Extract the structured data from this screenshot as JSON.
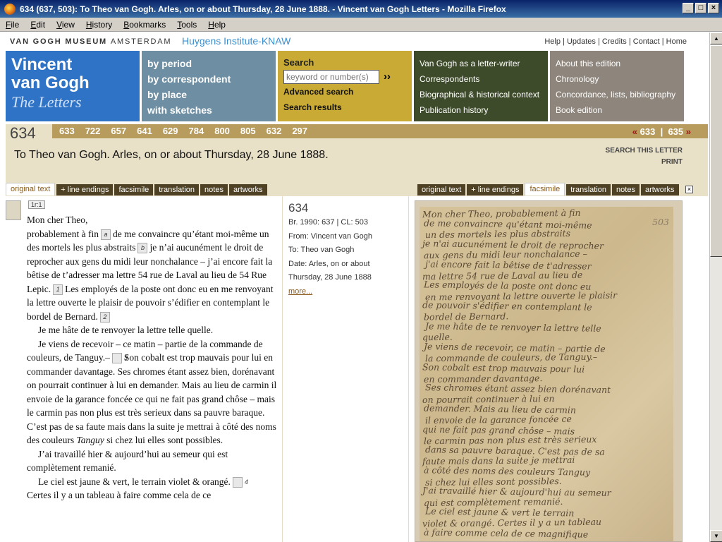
{
  "window": {
    "title": "634 (637, 503): To Theo van Gogh. Arles, on or about Thursday, 28 June 1888. - Vincent van Gogh Letters - Mozilla Firefox"
  },
  "menu": [
    "File",
    "Edit",
    "View",
    "History",
    "Bookmarks",
    "Tools",
    "Help"
  ],
  "site": {
    "museum": "VAN GOGH MUSEUM",
    "city": "AMSTERDAM",
    "huygens": "Huygens Institute-KNAW",
    "toplinks": [
      "Help",
      "Updates",
      "Credits",
      "Contact",
      "Home"
    ]
  },
  "brand": {
    "line1": "Vincent",
    "line2": "van Gogh",
    "line3": "The Letters"
  },
  "nav_browse": [
    "by period",
    "by correspondent",
    "by place",
    "with sketches"
  ],
  "search": {
    "title": "Search",
    "placeholder": "keyword or number(s)",
    "go": "››",
    "advanced": "Advanced search",
    "results": "Search results"
  },
  "nav_context": [
    "Van Gogh as a letter-writer",
    "Correspondents",
    "Biographical & historical context",
    "Publication history"
  ],
  "nav_edition": [
    "About this edition",
    "Chronology",
    "Concordance, lists, bibliography",
    "Book edition"
  ],
  "letter": {
    "number": "634",
    "related": [
      "633",
      "722",
      "657",
      "641",
      "629",
      "784",
      "800",
      "805",
      "632",
      "297"
    ],
    "prev": "633",
    "next": "635",
    "prev_arrow": "«",
    "next_arrow": "»",
    "title": "To Theo van Gogh. Arles, on or about Thursday, 28 June 1888.",
    "search_this": "SEARCH THIS LETTER",
    "print": "PRINT"
  },
  "tabs_left": [
    "original text",
    "+ line endings",
    "facsimile",
    "translation",
    "notes",
    "artworks"
  ],
  "tabs_right": [
    "original text",
    "+ line endings",
    "facsimile",
    "translation",
    "notes",
    "artworks"
  ],
  "page_marker": "1r:1",
  "text": {
    "p1": "Mon cher Theo,",
    "p2a": "probablement à fin",
    "n_a": "a",
    "p2b": "de me convaincre qu’étant moi-même un des mortels les plus abstraits",
    "n_b": "b",
    "p2c": "je n’ai aucunément le droit de reprocher aux gens du midi leur nonchalance – j’ai encore fait la bêtise de t’adresser ma lettre 54 rue de Laval au lieu de 54 Rue Lepic.",
    "n_1": "1",
    "p2d": "Les employés de la poste ont donc eu en me renvoyant la lettre ouverte le plaisir de pouvoir s’édifier en contemplant le bordel de Bernard.",
    "n_2": "2",
    "p3": "Je me hâte de te renvoyer la lettre telle quelle.",
    "p4a": "Je viens de recevoir – ce matin – partie de la commande de couleurs, de Tanguy.–",
    "n_3": "3",
    "p4b": "Son cobalt est trop mauvais pour lui en commander davantage. Ses chromes étant assez bien, dorénavant on pourrait continuer à lui en demander. Mais au lieu de carmin il envoie de la garance foncée ce qui ne fait pas grand chôse – mais le carmin pas non plus est très serieux dans sa pauvre baraque. C’est pas de sa faute mais dans la suite je mettrai à côté des noms des couleurs",
    "p4c": "Tanguy",
    "p4d": "si chez lui elles sont possibles.",
    "p5": "J’ai travaillé hier & aujourd’hui au semeur qui est complètement remanié.",
    "p6a": "Le ciel est jaune & vert, le terrain violet & orangé.",
    "n_4": "4",
    "p6b": "Certes il y a un tableau à faire comme cela de ce"
  },
  "meta": {
    "number": "634",
    "br": "Br. 1990: 637 | CL: 503",
    "from": "From: Vincent van Gogh",
    "to": "To: Theo van Gogh",
    "date1": "Date: Arles, on or about",
    "date2": "Thursday, 28 June 1888",
    "more": "more..."
  },
  "facsimile_lines": [
    "Mon cher Theo, probablement à fin",
    "de me convaincre qu'étant moi-même",
    "un des mortels les plus abstraits",
    "je n'ai aucunément le droit de reprocher",
    "aux gens du midi leur nonchalance –",
    "j'ai encore fait la bêtise de t'adresser",
    "ma lettre 54 rue de Laval au lieu de",
    "Les employés de la poste ont donc eu",
    "en me renvoyant la lettre ouverte le plaisir",
    "de pouvoir s'édifier en contemplant le",
    "bordel de Bernard.",
    "Je me hâte de te renvoyer la lettre telle",
    "quelle.",
    "Je viens de recevoir, ce matin – partie de",
    "la commande de couleurs, de Tanguy.–",
    "Son cobalt est trop mauvais pour lui",
    "en commander davantage.",
    "Ses chromes étant assez bien dorénavant",
    "on pourrait continuer à lui en",
    "demander. Mais au lieu de carmin",
    "il envoie de la garance foncée ce",
    "qui ne fait pas grand chôse – mais",
    "le carmin pas non plus est très serieux",
    "dans sa pauvre baraque. C'est pas de sa",
    "faute mais dans la suite je mettrai",
    "à côté des noms des couleurs Tanguy",
    "si chez lui elles sont possibles.",
    "J'ai travaillé hier & aujourd'hui au semeur",
    "qui est complètement remanié.",
    "Le ciel est jaune & vert le terrain",
    "violet & orangé. Certes il y a un tableau",
    "à faire comme cela de ce magnifique"
  ],
  "facsimile_pageno": "503"
}
